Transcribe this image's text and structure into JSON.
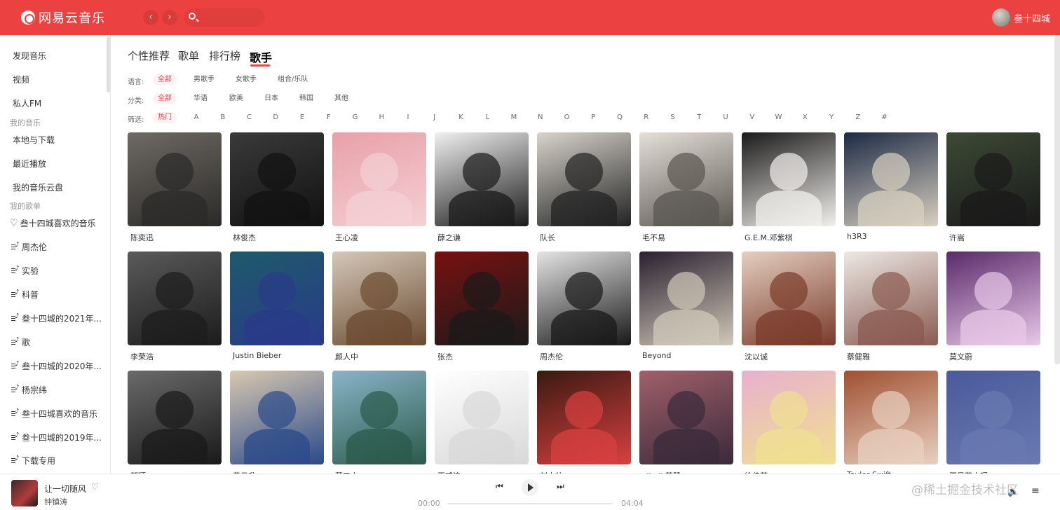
{
  "app": {
    "name": "网易云音乐"
  },
  "header": {
    "back_label": "‹",
    "forward_label": "›",
    "search_placeholder": "",
    "user_name": "叁十四城"
  },
  "sidebar": {
    "items": [
      {
        "label": "发现音乐"
      },
      {
        "label": "视频"
      },
      {
        "label": "私人FM"
      }
    ],
    "group_my_music": "我的音乐",
    "my_music_items": [
      {
        "label": "本地与下载"
      },
      {
        "label": "最近播放"
      },
      {
        "label": "我的音乐云盘"
      }
    ],
    "group_playlists": "我的歌单",
    "playlists": [
      {
        "label": "叁十四城喜欢的音乐",
        "icon": "heart-icon"
      },
      {
        "label": "周杰伦",
        "icon": "playlist-icon"
      },
      {
        "label": "实验",
        "icon": "playlist-icon"
      },
      {
        "label": "科普",
        "icon": "playlist-icon"
      },
      {
        "label": "叁十四城的2021年...",
        "icon": "playlist-icon"
      },
      {
        "label": "歌",
        "icon": "playlist-icon"
      },
      {
        "label": "叁十四城的2020年...",
        "icon": "playlist-icon"
      },
      {
        "label": "杨宗纬",
        "icon": "playlist-icon"
      },
      {
        "label": "叁十四城喜欢的音乐",
        "icon": "playlist-icon"
      },
      {
        "label": "叁十四城的2019年...",
        "icon": "playlist-icon"
      },
      {
        "label": "下载专用",
        "icon": "playlist-icon"
      }
    ]
  },
  "tabs": [
    "个性推荐",
    "歌单",
    "排行榜",
    "歌手"
  ],
  "active_tab": "歌手",
  "filters": {
    "language": {
      "label": "语言:",
      "options": [
        "全部",
        "男歌手",
        "女歌手",
        "组合/乐队"
      ],
      "selected": "全部"
    },
    "category": {
      "label": "分类:",
      "options": [
        "全部",
        "华语",
        "欧美",
        "日本",
        "韩国",
        "其他"
      ],
      "selected": "全部"
    },
    "initial": {
      "label": "筛选:",
      "options": [
        "热门",
        "A",
        "B",
        "C",
        "D",
        "E",
        "F",
        "G",
        "H",
        "I",
        "J",
        "K",
        "L",
        "M",
        "N",
        "O",
        "P",
        "Q",
        "R",
        "S",
        "T",
        "U",
        "V",
        "W",
        "X",
        "Y",
        "Z",
        "#"
      ],
      "selected": "热门"
    }
  },
  "artists": [
    {
      "name": "陈奕迅",
      "colors": [
        "#6e6a64",
        "#2b2a28"
      ]
    },
    {
      "name": "林俊杰",
      "colors": [
        "#3a3a3a",
        "#111111"
      ]
    },
    {
      "name": "王心凌",
      "colors": [
        "#e8a0a8",
        "#f4d0d4"
      ]
    },
    {
      "name": "薛之谦",
      "colors": [
        "#f0f0f0",
        "#1a1a1a"
      ]
    },
    {
      "name": "队长",
      "colors": [
        "#d8d4cc",
        "#222222"
      ]
    },
    {
      "name": "毛不易",
      "colors": [
        "#e4e0d8",
        "#5a5650"
      ]
    },
    {
      "name": "G.E.M.邓紫棋",
      "colors": [
        "#1a1a1a",
        "#f2f0ec"
      ]
    },
    {
      "name": "h3R3",
      "colors": [
        "#1c2a44",
        "#d8d0c0"
      ]
    },
    {
      "name": "许嵩",
      "colors": [
        "#3c4a34",
        "#1a1a1a"
      ]
    },
    {
      "name": "李荣浩",
      "colors": [
        "#5a5a5a",
        "#1c1c1c"
      ]
    },
    {
      "name": "Justin Bieber",
      "colors": [
        "#1e5a6a",
        "#2a3a8a"
      ]
    },
    {
      "name": "颜人中",
      "colors": [
        "#d4c8b8",
        "#6a4a30"
      ]
    },
    {
      "name": "张杰",
      "colors": [
        "#7a1010",
        "#1a1a1a"
      ]
    },
    {
      "name": "周杰伦",
      "colors": [
        "#e4e4e4",
        "#181818"
      ]
    },
    {
      "name": "Beyond",
      "colors": [
        "#2a2030",
        "#d0c8b8"
      ]
    },
    {
      "name": "沈以诚",
      "colors": [
        "#e4cfc0",
        "#7a3a2a"
      ]
    },
    {
      "name": "蔡健雅",
      "colors": [
        "#ece8e4",
        "#8a5a50"
      ]
    },
    {
      "name": "莫文蔚",
      "colors": [
        "#5a2a6a",
        "#e8c8e8"
      ]
    },
    {
      "name": "郭顶",
      "colors": [
        "#6a6a6a",
        "#1a1a1a"
      ]
    },
    {
      "name": "黄云升",
      "colors": [
        "#d8c8b0",
        "#2a4a8a"
      ]
    },
    {
      "name": "落五人",
      "colors": [
        "#8ab4c8",
        "#2a5a4a"
      ]
    },
    {
      "name": "王贰浪",
      "colors": [
        "#ffffff",
        "#d8d8d8"
      ]
    },
    {
      "name": "刘大壮",
      "colors": [
        "#3a1a10",
        "#d84040"
      ]
    },
    {
      "name": "yihuik苡慧",
      "colors": [
        "#a0606a",
        "#3a2a3a"
      ]
    },
    {
      "name": "徐佳莹",
      "colors": [
        "#e8b0d0",
        "#f0e090"
      ]
    },
    {
      "name": "Taylor Swift",
      "colors": [
        "#a05030",
        "#e8d0c0"
      ]
    },
    {
      "name": "不是花火呀",
      "colors": [
        "#4a5a9a",
        "#6a7ab0"
      ]
    }
  ],
  "player": {
    "song_title": "让一切随风",
    "artist": "钟镇涛",
    "current_time": "00:00",
    "total_time": "04:04",
    "progress": 0
  },
  "watermark": "@稀土掘金技术社区"
}
